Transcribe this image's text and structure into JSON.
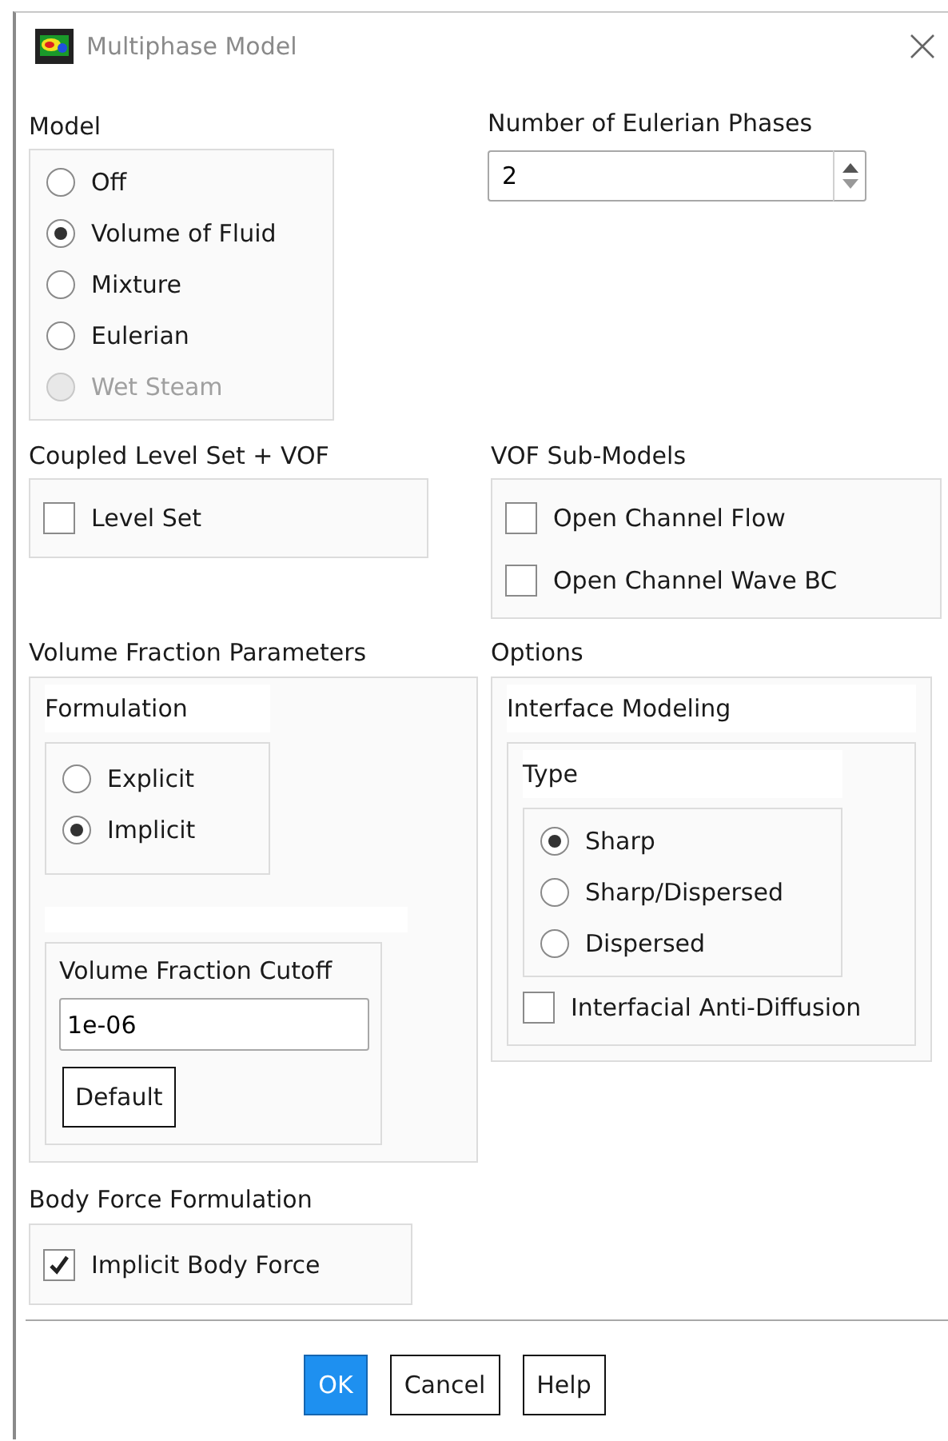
{
  "window": {
    "title": "Multiphase Model"
  },
  "model": {
    "label": "Model",
    "options": [
      {
        "label": "Off",
        "selected": false,
        "disabled": false
      },
      {
        "label": "Volume of Fluid",
        "selected": true,
        "disabled": false
      },
      {
        "label": "Mixture",
        "selected": false,
        "disabled": false
      },
      {
        "label": "Eulerian",
        "selected": false,
        "disabled": false
      },
      {
        "label": "Wet Steam",
        "selected": false,
        "disabled": true
      }
    ]
  },
  "eulerian_phases": {
    "label": "Number of Eulerian Phases",
    "value": "2"
  },
  "coupled_level_set": {
    "label": "Coupled Level Set + VOF",
    "options": [
      {
        "label": "Level Set",
        "checked": false
      }
    ]
  },
  "vof_sub_models": {
    "label": "VOF Sub-Models",
    "options": [
      {
        "label": "Open Channel Flow",
        "checked": false
      },
      {
        "label": "Open Channel Wave BC",
        "checked": false
      }
    ]
  },
  "volume_fraction_parameters": {
    "label": "Volume Fraction Parameters",
    "formulation": {
      "label": "Formulation",
      "options": [
        {
          "label": "Explicit",
          "selected": false
        },
        {
          "label": "Implicit",
          "selected": true
        }
      ]
    },
    "cutoff": {
      "label": "Volume Fraction Cutoff",
      "value": "1e-06",
      "button": "Default"
    }
  },
  "options": {
    "label": "Options",
    "interface_modeling": {
      "label": "Interface Modeling",
      "type": {
        "label": "Type",
        "options": [
          {
            "label": "Sharp",
            "selected": true
          },
          {
            "label": "Sharp/Dispersed",
            "selected": false
          },
          {
            "label": "Dispersed",
            "selected": false
          }
        ]
      },
      "anti_diffusion": {
        "label": "Interfacial Anti-Diffusion",
        "checked": false
      }
    }
  },
  "body_force": {
    "label": "Body Force Formulation",
    "options": [
      {
        "label": "Implicit Body Force",
        "checked": true
      }
    ]
  },
  "buttons": [
    {
      "label": "OK",
      "primary": true
    },
    {
      "label": "Cancel",
      "primary": false
    },
    {
      "label": "Help",
      "primary": false
    }
  ]
}
